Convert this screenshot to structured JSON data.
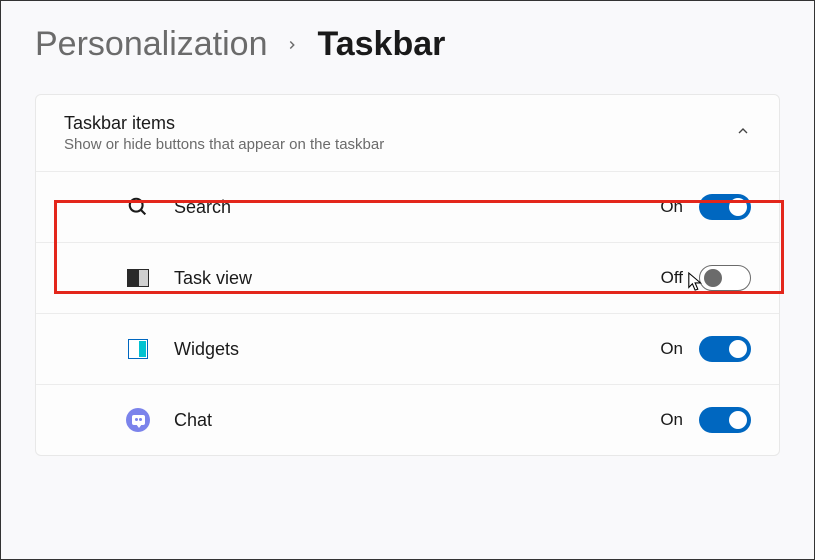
{
  "breadcrumb": {
    "parent": "Personalization",
    "current": "Taskbar"
  },
  "section": {
    "title": "Taskbar items",
    "subtitle": "Show or hide buttons that appear on the taskbar",
    "expanded": true
  },
  "labels": {
    "on": "On",
    "off": "Off"
  },
  "items": [
    {
      "icon": "search-icon",
      "label": "Search",
      "enabled": true
    },
    {
      "icon": "taskview-icon",
      "label": "Task view",
      "enabled": false
    },
    {
      "icon": "widgets-icon",
      "label": "Widgets",
      "enabled": true
    },
    {
      "icon": "chat-icon",
      "label": "Chat",
      "enabled": true
    }
  ],
  "highlight": {
    "target_item": 0
  }
}
